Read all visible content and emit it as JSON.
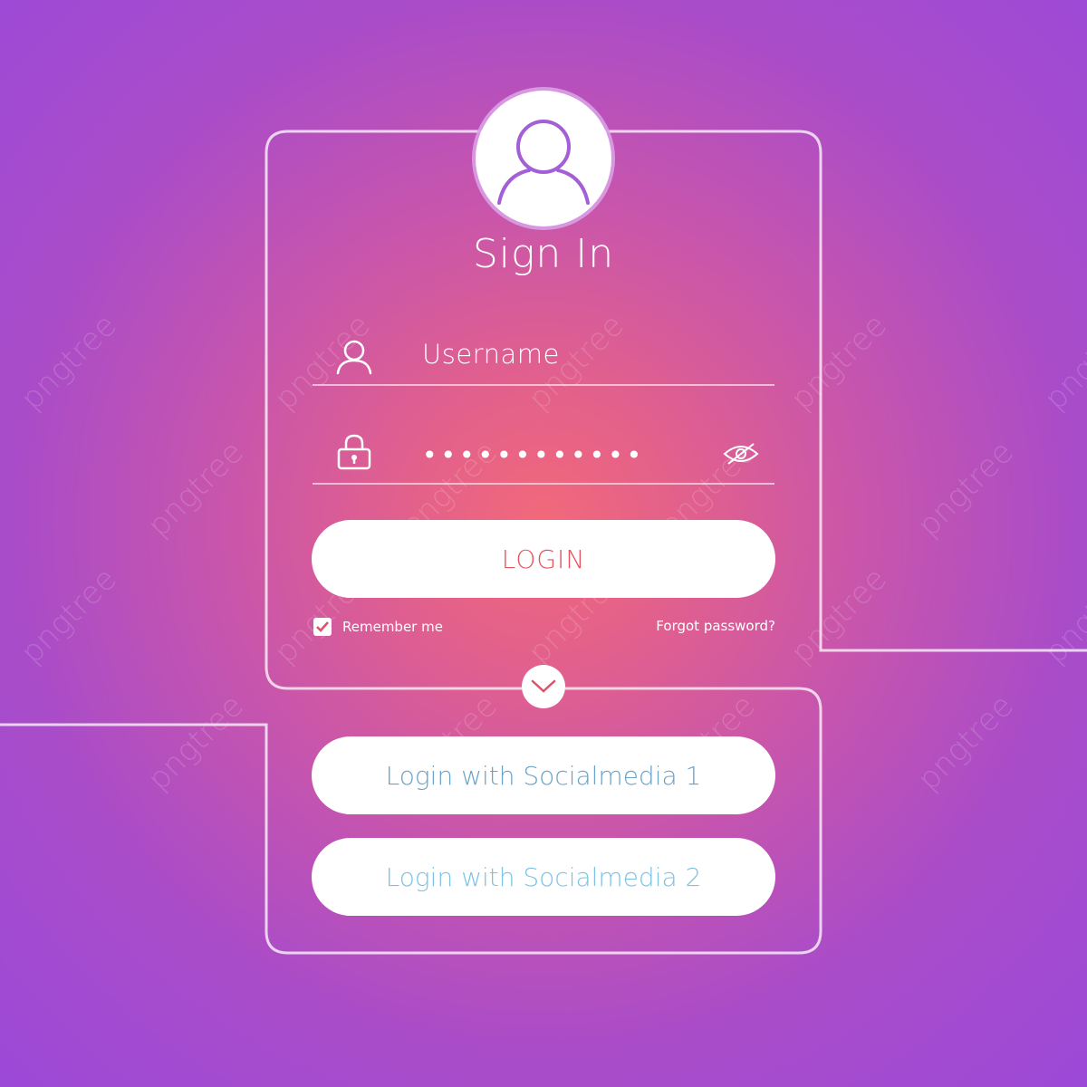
{
  "form": {
    "title": "Sign In",
    "username_placeholder": "Username",
    "password_mask": "••••••••••••",
    "login_label": "LOGIN",
    "remember_label": "Remember me",
    "remember_checked": true,
    "forgot_label": "Forgot password?"
  },
  "social": {
    "button_1": "Login with Socialmedia 1",
    "button_2": "Login with Socialmedia 2"
  },
  "watermark": "pngtree",
  "icons": {
    "avatar": "user-avatar-icon",
    "username": "user-icon",
    "password": "padlock-icon",
    "visibility": "eye-hidden-icon",
    "toggle": "chevron-down-icon",
    "checkbox": "checkmark-icon"
  },
  "colors": {
    "background_center": "#f2697a",
    "background_edge": "#9c49d8",
    "login_text": "#e5545f",
    "social_1_text": "#6aa3c9",
    "social_2_text": "#7bc3e6",
    "avatar_stroke": "#a45ed6"
  }
}
